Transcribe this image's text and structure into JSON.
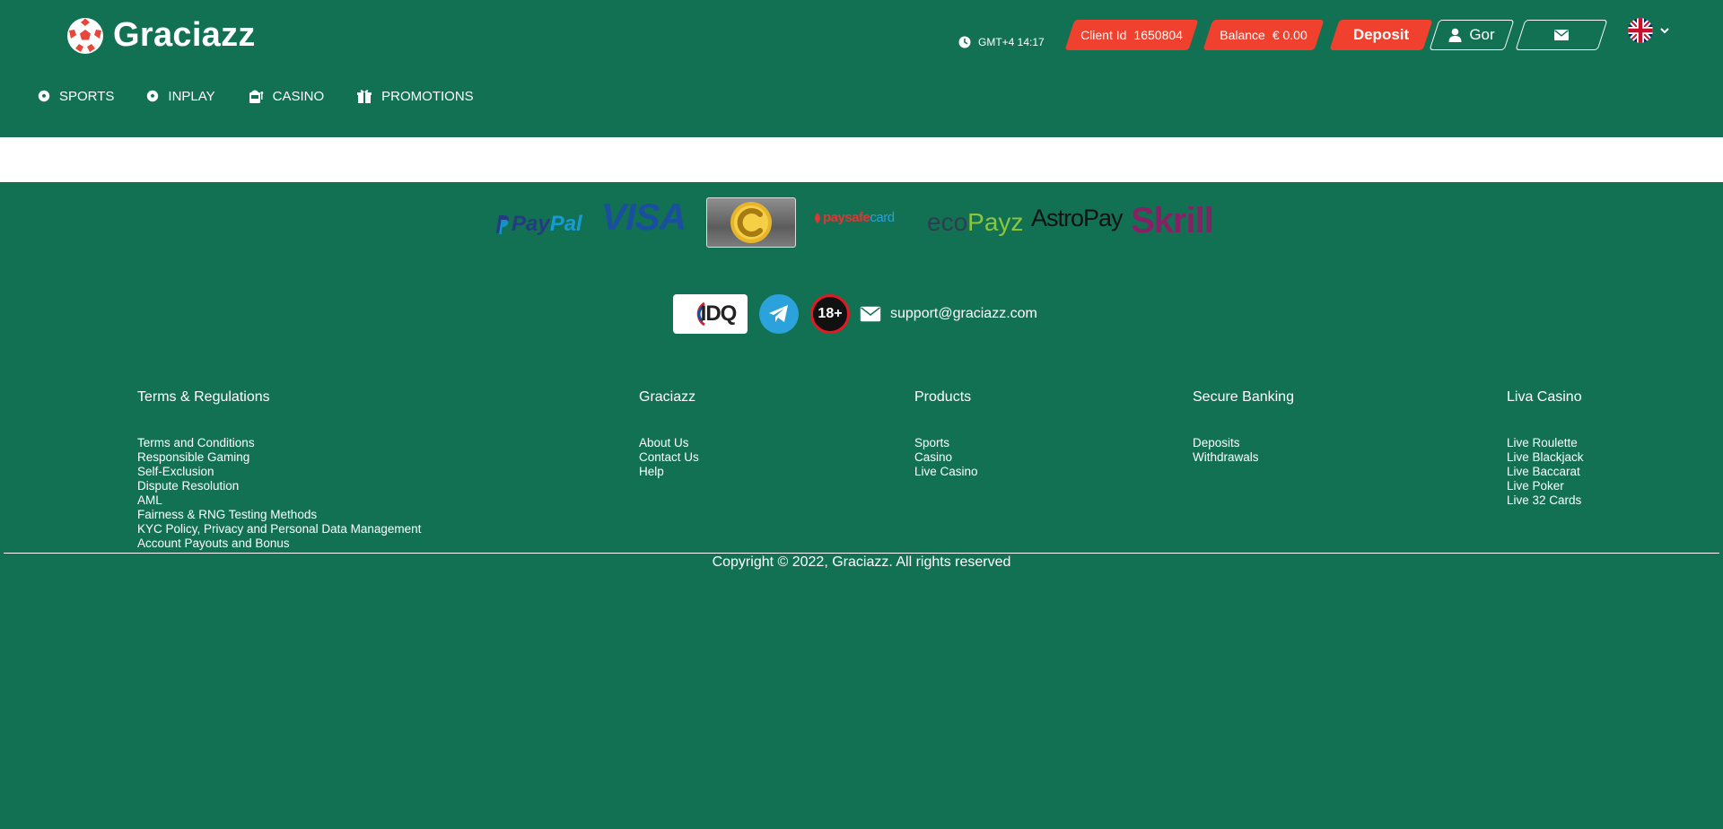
{
  "brand": {
    "name": "Graciazz"
  },
  "header": {
    "timezone": "GMT+4 14:17",
    "client_label": "Client Id",
    "client_id": "1650804",
    "balance_label": "Balance",
    "balance_value": "€ 0.00",
    "deposit_label": "Deposit",
    "user_name": "Gor"
  },
  "nav": [
    {
      "label": "SPORTS"
    },
    {
      "label": "INPLAY"
    },
    {
      "label": "CASINO"
    },
    {
      "label": "PROMOTIONS"
    }
  ],
  "payments": {
    "paypal_a": "Pay",
    "paypal_b": "Pal",
    "visa": "VISA",
    "paysafe_a": "paysafe",
    "paysafe_b": "card",
    "eco_a": "eco",
    "eco_b": "Payz",
    "astropay": "AstroPay",
    "skrill": "Skrill"
  },
  "trust": {
    "idq": "IDQ",
    "age": "18+",
    "support_email": "support@graciazz.com"
  },
  "footer": {
    "columns": [
      {
        "title": "Terms & Regulations",
        "links": [
          "Terms and Conditions",
          "Responsible Gaming",
          "Self-Exclusion",
          "Dispute Resolution",
          "AML",
          "Fairness & RNG Testing Methods",
          "KYC Policy, Privacy and Personal Data Management",
          "Account Payouts and Bonus"
        ]
      },
      {
        "title": "Graciazz",
        "links": [
          "About Us",
          "Contact Us",
          "Help"
        ]
      },
      {
        "title": "Products",
        "links": [
          "Sports",
          "Casino",
          "Live Casino"
        ]
      },
      {
        "title": "Secure Banking",
        "links": [
          "Deposits",
          "Withdrawals"
        ]
      },
      {
        "title": "Liva Casino",
        "links": [
          "Live Roulette",
          "Live Blackjack",
          "Live Baccarat",
          "Live Poker",
          "Live 32 Cards"
        ]
      }
    ],
    "copyright": "Copyright © 2022, Graciazz. All rights reserved"
  },
  "colors": {
    "background": "#127152",
    "accent": "#f0412f"
  }
}
